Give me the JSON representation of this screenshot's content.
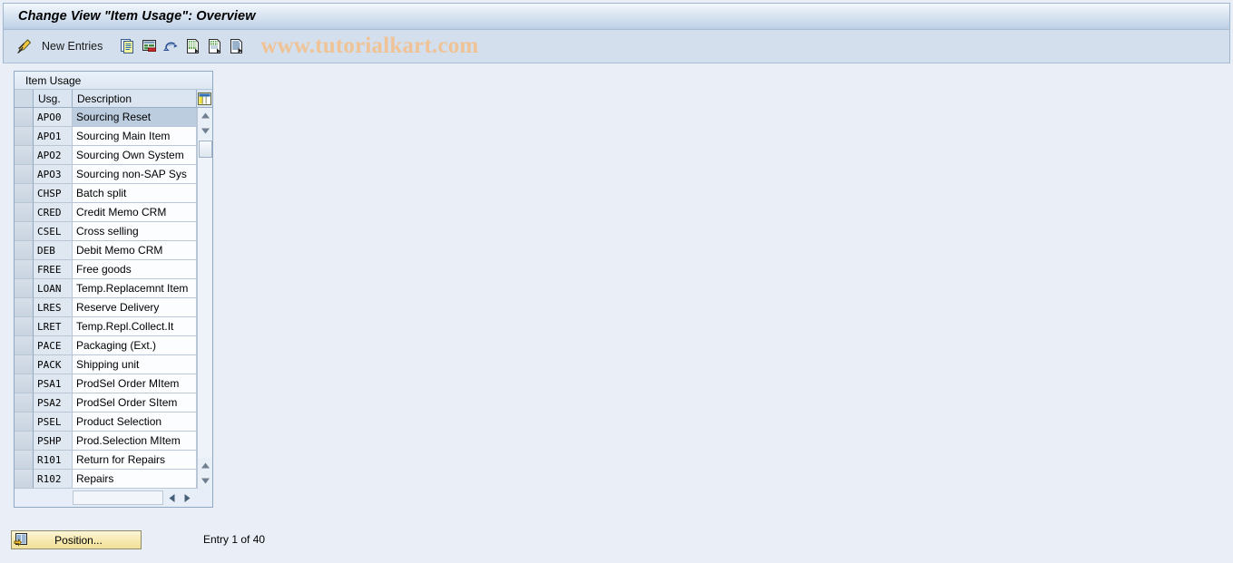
{
  "window": {
    "title": "Change View \"Item Usage\": Overview"
  },
  "toolbar": {
    "edit_icon": "pencil-edit-icon",
    "new_entries_label": "New Entries",
    "copy_icon": "copy-as-icon",
    "delete_icon": "delete-icon",
    "undo_icon": "undo-icon",
    "select_all_icon": "select-all-icon",
    "deselect_all_icon": "deselect-all-icon",
    "details_icon": "details-icon",
    "watermark": "www.tutorialkart.com"
  },
  "table": {
    "caption": "Item Usage",
    "columns": [
      {
        "key": "usg",
        "label": "Usg."
      },
      {
        "key": "desc",
        "label": "Description"
      }
    ],
    "config_icon": "column-config-icon",
    "selected_row_index": 0,
    "rows": [
      {
        "usg": "APO0",
        "desc": "Sourcing Reset"
      },
      {
        "usg": "APO1",
        "desc": "Sourcing Main Item"
      },
      {
        "usg": "APO2",
        "desc": "Sourcing Own System"
      },
      {
        "usg": "APO3",
        "desc": "Sourcing non-SAP Sys"
      },
      {
        "usg": "CHSP",
        "desc": "Batch split"
      },
      {
        "usg": "CRED",
        "desc": "Credit Memo CRM"
      },
      {
        "usg": "CSEL",
        "desc": "Cross selling"
      },
      {
        "usg": "DEB",
        "desc": "Debit Memo CRM"
      },
      {
        "usg": "FREE",
        "desc": "Free goods"
      },
      {
        "usg": "LOAN",
        "desc": "Temp.Replacemnt Item"
      },
      {
        "usg": "LRES",
        "desc": "Reserve Delivery"
      },
      {
        "usg": "LRET",
        "desc": "Temp.Repl.Collect.It"
      },
      {
        "usg": "PACE",
        "desc": "Packaging (Ext.)"
      },
      {
        "usg": "PACK",
        "desc": "Shipping unit"
      },
      {
        "usg": "PSA1",
        "desc": "ProdSel Order MItem"
      },
      {
        "usg": "PSA2",
        "desc": "ProdSel Order SItem"
      },
      {
        "usg": "PSEL",
        "desc": "Product Selection"
      },
      {
        "usg": "PSHP",
        "desc": "Prod.Selection MItem"
      },
      {
        "usg": "R101",
        "desc": "Return for Repairs"
      },
      {
        "usg": "R102",
        "desc": "Repairs"
      }
    ],
    "scroll_up_icon": "scroll-up-arrow-icon",
    "scroll_down_icon": "scroll-down-arrow-icon",
    "scroll_left_icon": "scroll-left-arrow-icon",
    "scroll_right_icon": "scroll-right-arrow-icon"
  },
  "footer": {
    "position_label": "Position...",
    "position_icon": "position-goto-icon",
    "entry_status": "Entry 1 of 40"
  },
  "colors": {
    "page_background": "#eaeff7",
    "titlebar_gradient_start": "#f4f8fc",
    "titlebar_gradient_end": "#b8cbe2",
    "toolbar_background": "#d3dfec",
    "watermark": "#f0c396",
    "row_selected": "#bdcde0",
    "button_yellow": "#f2e19b",
    "grid_border": "#b8c6d6"
  }
}
